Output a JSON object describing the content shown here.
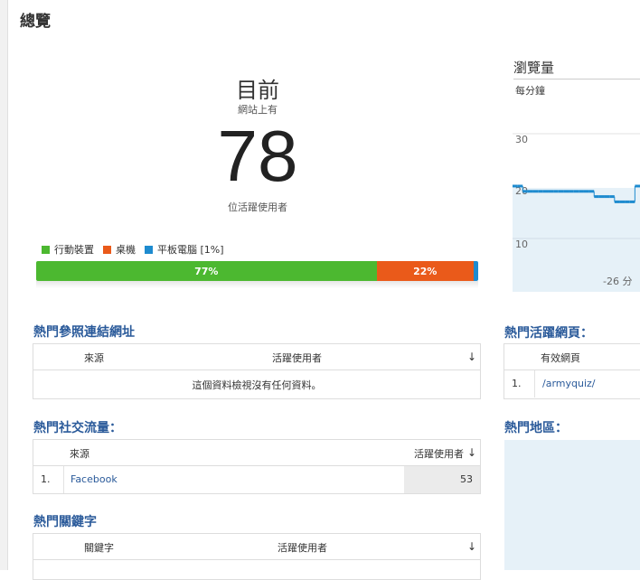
{
  "page": {
    "title": "總覽"
  },
  "realtime": {
    "now_label": "目前",
    "site_label": "網站上有",
    "active_users": "78",
    "caption": "位活躍使用者",
    "devices": [
      {
        "label": "行動裝置",
        "percent": 77,
        "percent_text": "77%",
        "color": "#4cb830"
      },
      {
        "label": "桌機",
        "percent": 22,
        "percent_text": "22%",
        "color": "#ea5a1a"
      },
      {
        "label": "平板電腦 [1%]",
        "percent": 1,
        "percent_text": "",
        "color": "#1e8bcf"
      }
    ]
  },
  "pageviews": {
    "title": "瀏覽量",
    "subtitle": "每分鐘",
    "ticks": [
      "30",
      "20",
      "10"
    ],
    "x_label": "-26 分"
  },
  "chart_data": {
    "type": "line",
    "title": "瀏覽量",
    "ylabel": "每分鐘",
    "xlabel": "-26 分",
    "ylim": [
      0,
      35
    ],
    "x": [
      -26,
      -25,
      -24,
      -23,
      -22,
      -21,
      -20,
      -19,
      -18,
      -17,
      -16,
      -15,
      -14,
      -13,
      -12,
      -11,
      -10,
      -9,
      -8,
      -7,
      -6,
      -5,
      -4,
      -3,
      -2,
      -1
    ],
    "series": [
      {
        "values": [
          20,
          20,
          19,
          19,
          19,
          19,
          19,
          19,
          19,
          19,
          19,
          19,
          19,
          19,
          19,
          19,
          18,
          18,
          18,
          18,
          17,
          17,
          17,
          17,
          20,
          20
        ]
      }
    ],
    "grid": true,
    "color": "#1e8bcf"
  },
  "referrals": {
    "title": "熱門參照連結網址",
    "col_source": "來源",
    "col_users": "活躍使用者",
    "empty": "這個資料檢視沒有任何資料。"
  },
  "social": {
    "title": "熱門社交流量：",
    "col_source": "來源",
    "col_users": "活躍使用者",
    "rows": [
      {
        "index": "1.",
        "source": "Facebook",
        "users": "53"
      }
    ]
  },
  "keywords": {
    "title": "熱門關鍵字",
    "col_keyword": "關鍵字",
    "col_users": "活躍使用者"
  },
  "active_pages": {
    "title": "熱門活躍網頁：",
    "col_page": "有效網頁",
    "rows": [
      {
        "index": "1.",
        "page": "/armyquiz/"
      }
    ]
  },
  "locations": {
    "title": "熱門地區："
  }
}
